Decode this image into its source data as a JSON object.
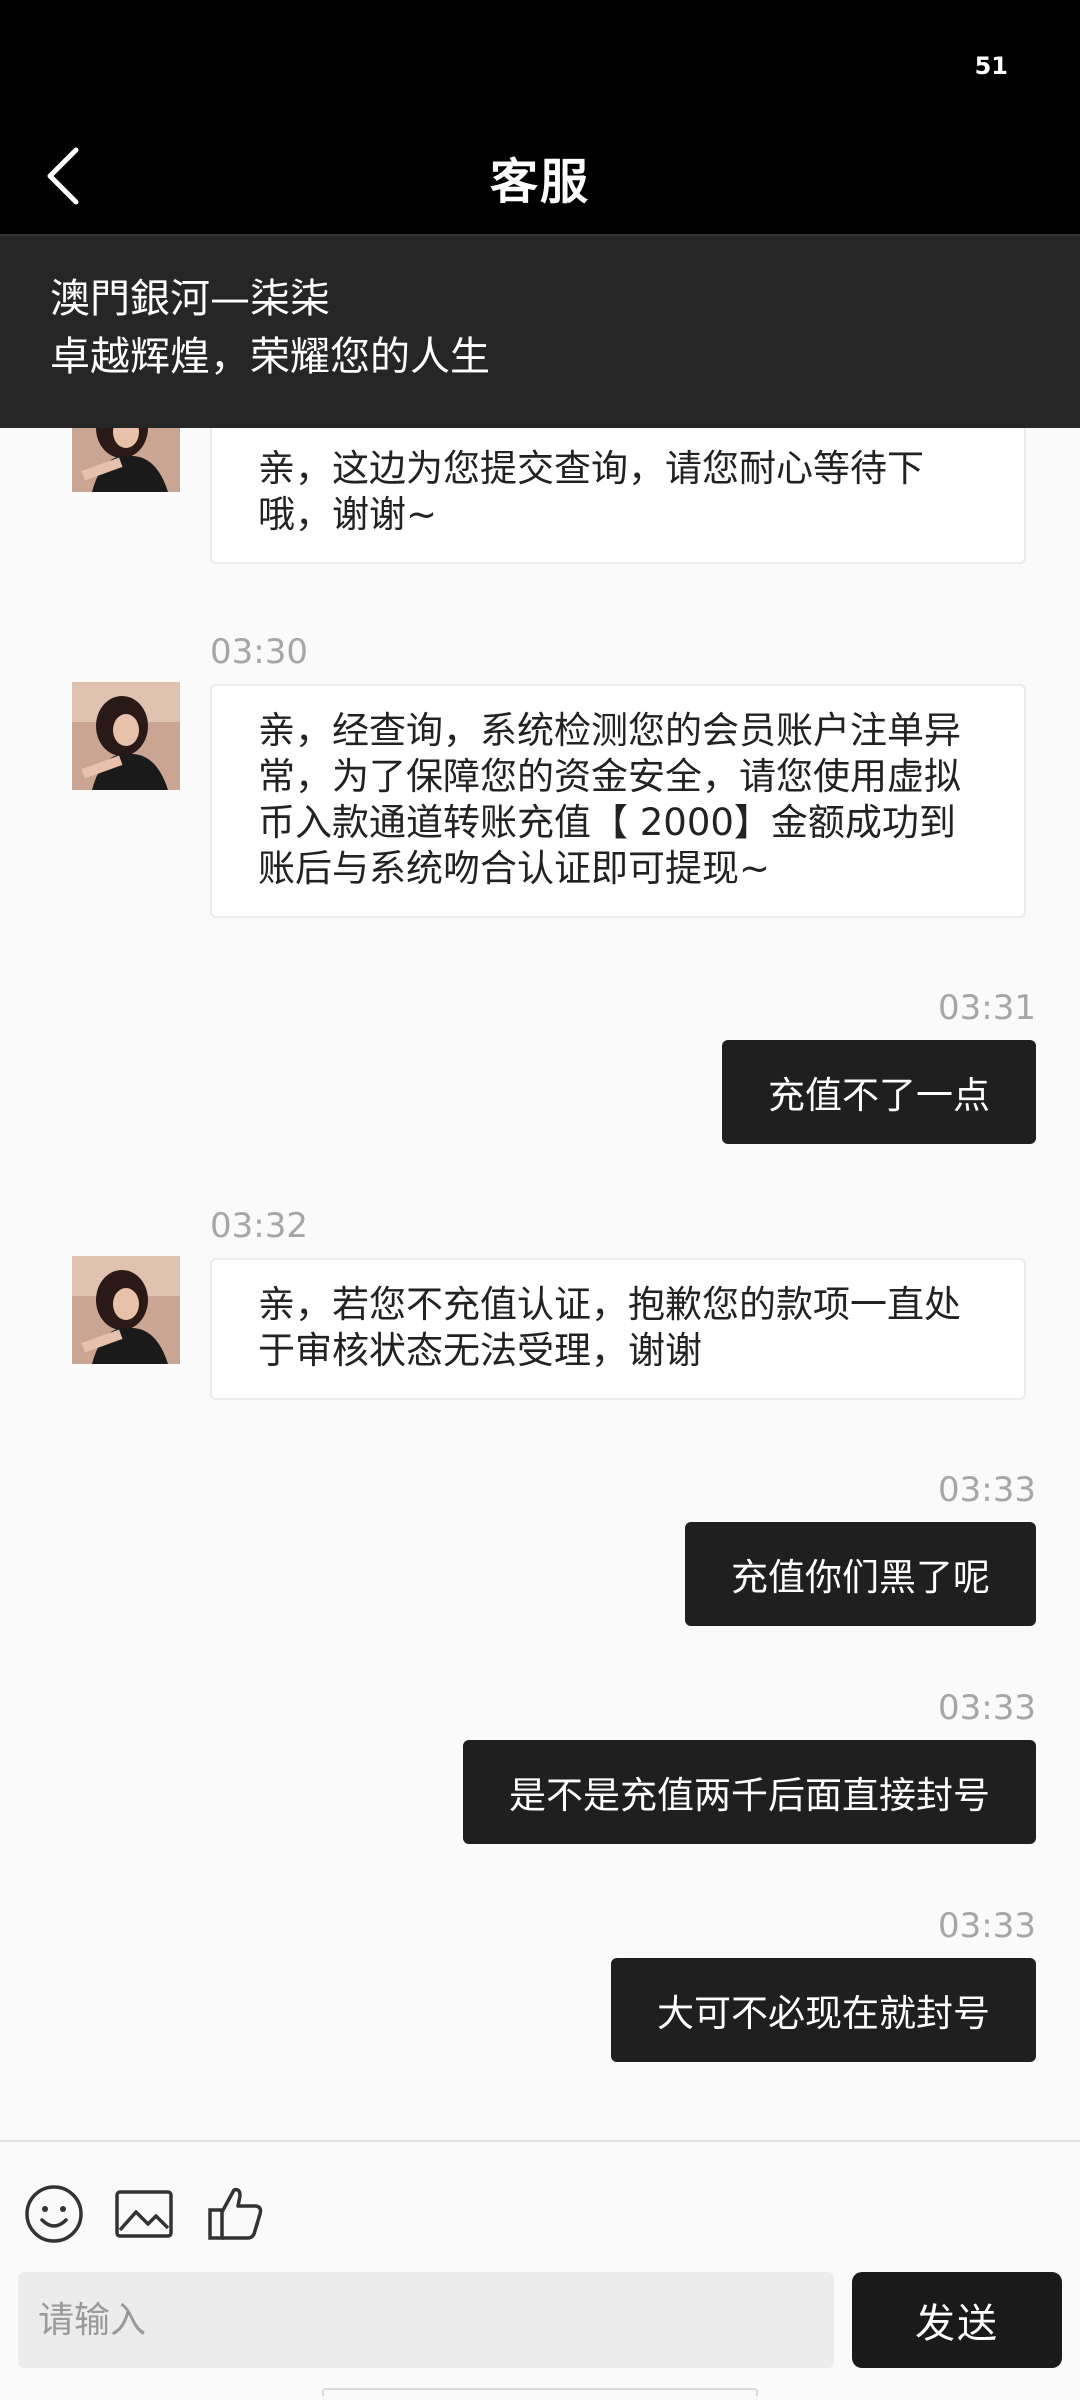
{
  "status_bar": {
    "battery": "51"
  },
  "header": {
    "title": "客服"
  },
  "banner": {
    "line1": "澳門銀河—柒柒",
    "line2": "卓越辉煌，荣耀您的人生"
  },
  "messages": [
    {
      "side": "in",
      "time": "",
      "text": "亲，这边为您提交查询，请您耐心等待下哦，谢谢~"
    },
    {
      "side": "in",
      "time": "03:30",
      "text": "亲，经查询，系统检测您的会员账户注单异常，为了保障您的资金安全，请您使用虚拟币入款通道转账充值【 2000】金额成功到账后与系统吻合认证即可提现~"
    },
    {
      "side": "out",
      "time": "03:31",
      "text": "充值不了一点"
    },
    {
      "side": "in",
      "time": "03:32",
      "text": "亲，若您不充值认证，抱歉您的款项一直处于审核状态无法受理，谢谢"
    },
    {
      "side": "out",
      "time": "03:33",
      "text": "充值你们黑了呢"
    },
    {
      "side": "out",
      "time": "03:33",
      "text": "是不是充值两千后面直接封号"
    },
    {
      "side": "out",
      "time": "03:33",
      "text": "大可不必现在就封号"
    }
  ],
  "composer": {
    "placeholder": "请输入",
    "send_label": "发送",
    "tools": [
      "emoji-icon",
      "image-icon",
      "thumbs-up-icon"
    ]
  },
  "colors": {
    "bar": "#000000",
    "banner": "#262626",
    "outgoing_bubble": "#1f1f1f",
    "incoming_bubble": "#ffffff",
    "background": "#fafafa"
  }
}
